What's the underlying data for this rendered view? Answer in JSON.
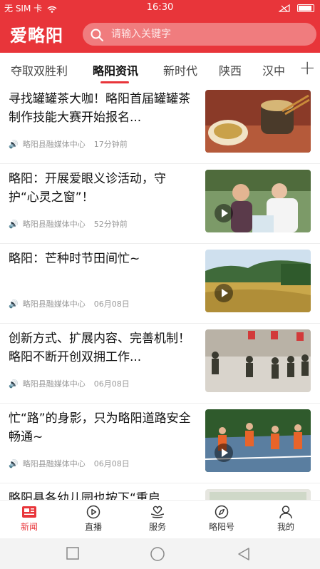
{
  "status_bar": {
    "carrier": "无 SIM 卡",
    "time": "16:30"
  },
  "header": {
    "logo": "爱略阳",
    "search_placeholder": "请输入关键字"
  },
  "tabs": [
    {
      "label": "夺取双胜利"
    },
    {
      "label": "略阳资讯",
      "active": true
    },
    {
      "label": "新时代"
    },
    {
      "label": "陕西"
    },
    {
      "label": "汉中"
    }
  ],
  "feed": [
    {
      "title": "寻找罐罐茶大咖！略阳首届罐罐茶制作技能大赛开始报名...",
      "source": "略阳县融媒体中心",
      "time": "17分钟前",
      "thumb": "tea-and-food-photo",
      "video": false
    },
    {
      "title": "略阳：开展爱眼义诊活动，守护“心灵之窗”！",
      "source": "略阳县融媒体中心",
      "time": "52分钟前",
      "thumb": "eye-clinic-photo",
      "video": true
    },
    {
      "title": "略阳：芒种时节田间忙~",
      "source": "略阳县融媒体中心",
      "time": "06月08日",
      "thumb": "wheat-field-photo",
      "video": true
    },
    {
      "title": "创新方式、扩展内容、完善机制！略阳不断开创双拥工作...",
      "source": "略阳县融媒体中心",
      "time": "06月08日",
      "thumb": "soldiers-training-photo",
      "video": true
    },
    {
      "title": "忙“路”的身影，只为略阳道路安全畅通~",
      "source": "略阳县融媒体中心",
      "time": "06月08日",
      "thumb": "road-workers-photo",
      "video": true
    },
    {
      "title": "略阳县各幼儿园也按下“重启",
      "source": "",
      "time": "",
      "thumb": "kindergarten-photo",
      "video": false
    }
  ],
  "bottom_nav": [
    {
      "label": "新闻",
      "icon": "news-icon",
      "active": true
    },
    {
      "label": "直播",
      "icon": "live-icon"
    },
    {
      "label": "服务",
      "icon": "service-icon"
    },
    {
      "label": "略阳号",
      "icon": "compass-icon"
    },
    {
      "label": "我的",
      "icon": "profile-icon"
    }
  ],
  "colors": {
    "brand": "#e8353a"
  }
}
